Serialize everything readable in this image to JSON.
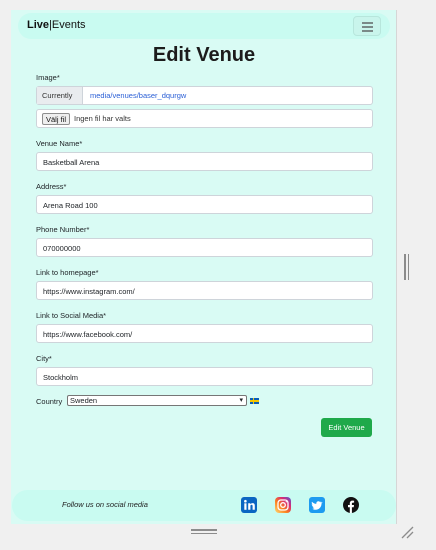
{
  "navbar": {
    "brand_bold": "Live",
    "brand_sep": "|",
    "brand_rest": "Events",
    "toggle_icon": "hamburger-icon"
  },
  "page": {
    "title": "Edit Venue"
  },
  "form": {
    "image": {
      "label": "Image*",
      "current_label": "Currently",
      "current_value": "media/venues/baser_dqurgw",
      "file_button": "Välj fil",
      "file_status": "Ingen fil har valts"
    },
    "venue_name": {
      "label": "Venue Name*",
      "value": "Basketball Arena"
    },
    "address": {
      "label": "Address*",
      "value": "Arena Road 100"
    },
    "phone": {
      "label": "Phone Number*",
      "value": "070000000"
    },
    "homepage": {
      "label": "Link to homepage*",
      "value": "https://www.instagram.com/"
    },
    "social": {
      "label": "Link to Social Media*",
      "value": "https://www.facebook.com/"
    },
    "city": {
      "label": "City*",
      "value": "Stockholm"
    },
    "country": {
      "label": "Country",
      "value": "Sweden",
      "flag": "sweden-flag"
    },
    "submit_label": "Edit Venue"
  },
  "footer": {
    "text": "Follow us on social media",
    "icons": [
      "linkedin-icon",
      "instagram-icon",
      "twitter-icon",
      "facebook-icon"
    ]
  },
  "colors": {
    "page_bg": "#d9fbf4",
    "nav_bg": "#c9fbf1",
    "submit": "#1fa94a",
    "link": "#2a5fd6"
  }
}
